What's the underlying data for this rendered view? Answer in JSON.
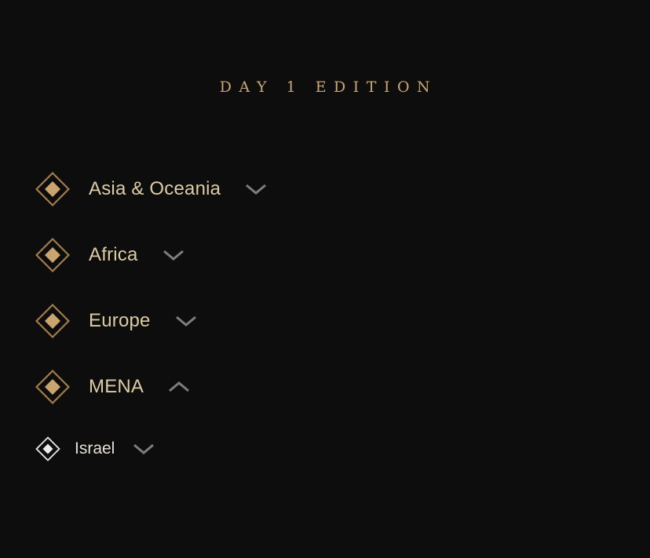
{
  "header": {
    "title": "DAY 1 EDITION"
  },
  "regions": [
    {
      "label": "Asia & Oceania",
      "expanded": false
    },
    {
      "label": "Africa",
      "expanded": false
    },
    {
      "label": "Europe",
      "expanded": false
    },
    {
      "label": "MENA",
      "expanded": true
    }
  ],
  "countries": [
    {
      "label": "Israel",
      "expanded": false
    }
  ],
  "colors": {
    "background": "#0d0d0d",
    "accent_gold": "#c9a773",
    "chevron_gray": "#7d7d7d",
    "label_light": "#dccba4"
  }
}
